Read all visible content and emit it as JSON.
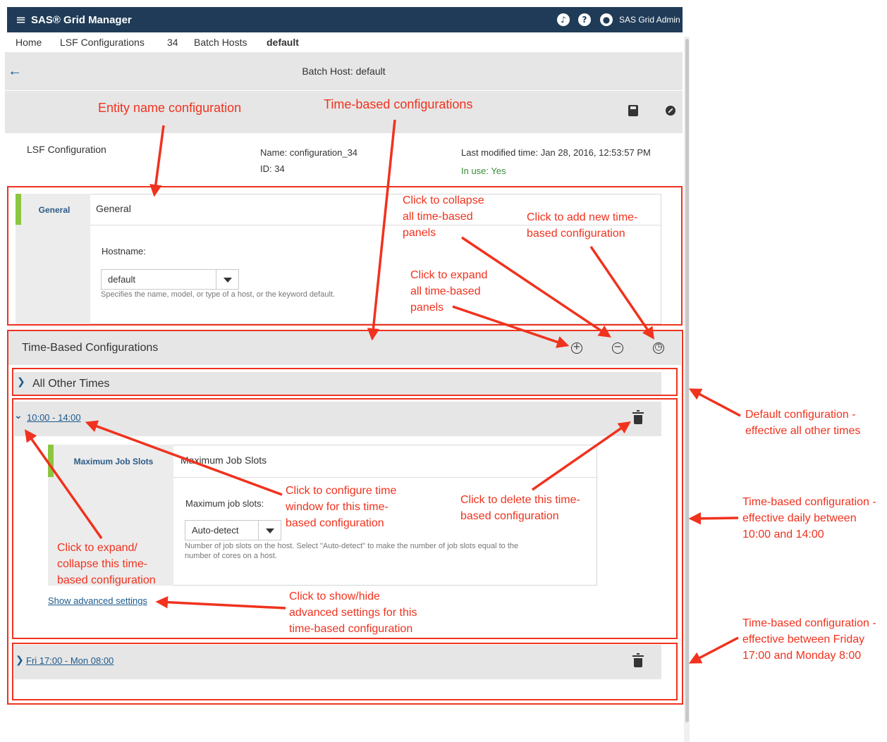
{
  "app": {
    "title": "SAS® Grid Manager",
    "user": "SAS Grid Admin",
    "menu_glyph": "≡"
  },
  "breadcrumb": {
    "items": [
      "Home",
      "LSF Configurations",
      "34",
      "Batch Hosts"
    ],
    "current": "default"
  },
  "page": {
    "title": "Batch Host: default"
  },
  "config": {
    "label": "LSF Configuration",
    "name": "Name: configuration_34",
    "id": "ID: 34",
    "modified": "Last modified time: Jan 28, 2016, 12:53:57 PM",
    "in_use": "In use: Yes",
    "in_use_color": "#3a8a3a"
  },
  "general": {
    "tab_label": "General",
    "title": "General",
    "hostname_label": "Hostname:",
    "hostname_value": "default",
    "hostname_help": "Specifies the name, model, or type of a host, or the keyword default."
  },
  "time_based": {
    "title": "Time-Based Configurations",
    "sections": [
      {
        "label": "All Other Times",
        "expanded": false
      },
      {
        "label": "10:00 - 14:00",
        "expanded": true
      },
      {
        "label": "Fri 17:00 - Mon 08:00",
        "expanded": false
      }
    ],
    "max_job_slots": {
      "tab_label": "Maximum Job Slots",
      "title": "Maximum Job Slots",
      "field_label": "Maximum job slots:",
      "value": "Auto-detect",
      "help_1": "Number of job slots on the host. Select \"Auto-detect\" to make the number of job slots equal to the",
      "help_2": "number of cores on a host."
    },
    "advanced_link": "Show advanced settings"
  },
  "annotations": {
    "entity_name": "Entity name configuration",
    "time_based": "Time-based configurations",
    "collapse_all": [
      "Click to collapse",
      "all time-based",
      "panels"
    ],
    "add_new": [
      "Click to add new time-",
      "based configuration"
    ],
    "expand_all": [
      "Click to expand",
      "all time-based",
      "panels"
    ],
    "configure_window": [
      "Click to configure time",
      "window for this time-",
      "based configuration"
    ],
    "delete": [
      "Click to delete this time-",
      "based configuration"
    ],
    "expand_collapse": [
      "Click to expand/",
      "collapse this time-",
      "based configuration"
    ],
    "show_hide_advanced": [
      "Click to show/hide",
      "advanced settings for this",
      "time-based configuration"
    ],
    "default_config": [
      "Default configuration -",
      "effective all other times"
    ],
    "daily_config": [
      "Time-based configuration -",
      "effective daily between",
      "10:00 and 14:00"
    ],
    "weekend_config": [
      "Time-based configuration -",
      "effective between Friday",
      "17:00 and Monday 8:00"
    ],
    "color": "#f0321e"
  }
}
